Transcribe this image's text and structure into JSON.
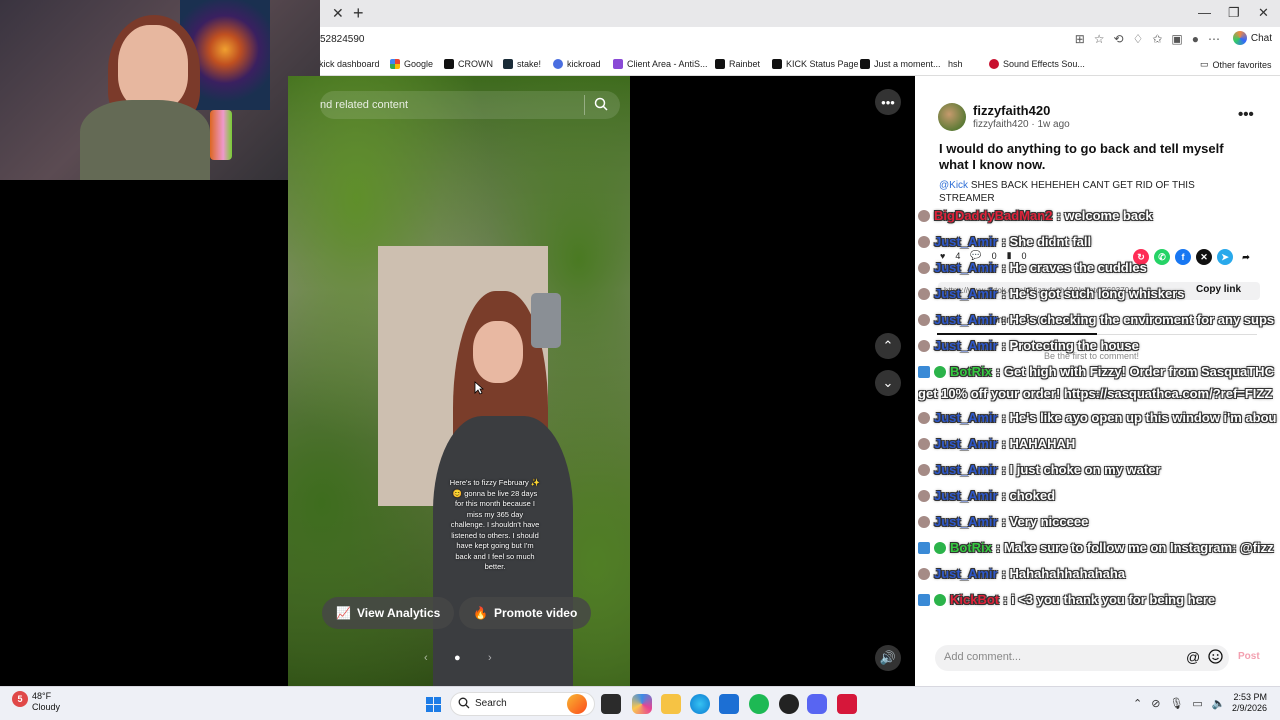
{
  "browser": {
    "url": "52824590",
    "chat_label": "Chat",
    "other_favorites": "Other favorites",
    "favorites": [
      {
        "label": "kick dashboard",
        "icon": "kick-icon"
      },
      {
        "label": "Google",
        "icon": "google-icon"
      },
      {
        "label": "CROWN",
        "icon": "crown-icon"
      },
      {
        "label": "stake!",
        "icon": "stake-icon"
      },
      {
        "label": "kickroad",
        "icon": "kickroad-icon"
      },
      {
        "label": "Client Area - AntiS...",
        "icon": "client-area-icon"
      },
      {
        "label": "Rainbet",
        "icon": "rainbet-icon"
      },
      {
        "label": "KICK Status Page",
        "icon": "kick-icon"
      },
      {
        "label": "Just a moment...",
        "icon": "kick-icon"
      },
      {
        "label": "hsh",
        "icon": "link-icon"
      },
      {
        "label": "Sound Effects Sou...",
        "icon": "sound-icon"
      }
    ]
  },
  "video": {
    "search_placeholder": "nd related content",
    "caption": "Here's to fizzy February ✨\n😊 gonna be live 28 days\nfor this month because I\nmiss my 365 day\nchallenge. I shouldn't have\nlistened to others. I should\nhave kept going but I'm\nback and I feel so much\nbetter.",
    "analytics_label": "View Analytics",
    "promote_label": "Promote video"
  },
  "post": {
    "display_name": "fizzyfaith420",
    "username": "fizzyfaith420",
    "age": "1w ago",
    "title": "I would do anything to go back and tell myself what I know now.",
    "mention": "@Kick",
    "description": " SHES BACK HEHEHEH CANT GET RID OF THIS STREAMER",
    "likes": "4",
    "comments": "0",
    "saves": "0",
    "link": "https://www.tiktok.com/@fizzyfaith420/photo/7603704...",
    "copy_link": "Copy link",
    "comments_tab": "Comments (0)",
    "empty_comments": "Be the first to comment!",
    "comment_placeholder": "Add comment...",
    "post_label": "Post"
  },
  "chat": [
    {
      "name": "BigDaddyBadMan2",
      "color": "#e0223a",
      "msg": ": welcome back",
      "badge": "usr"
    },
    {
      "name": "Just_Amir",
      "color": "#2d57c9",
      "msg": ": She didnt fall",
      "badge": "usr"
    },
    {
      "name": "Just_Amir",
      "color": "#2d57c9",
      "msg": ": He craves the cuddles",
      "badge": "usr"
    },
    {
      "name": "Just_Amir",
      "color": "#2d57c9",
      "msg": ": He's got such long whiskers",
      "badge": "usr"
    },
    {
      "name": "Just_Amir",
      "color": "#2d57c9",
      "msg": ": He's checking the enviroment for any sups",
      "badge": "usr"
    },
    {
      "name": "Just_Amir",
      "color": "#2d57c9",
      "msg": ": Protecting the house",
      "badge": "usr"
    },
    {
      "name": "BotRix",
      "color": "#35c940",
      "msg": ": Get high with Fizzy! Order from SasquaTHC",
      "badge": "bot"
    },
    {
      "name": "",
      "color": "#35c940",
      "msg": "get 10% off your order! https://sasquathca.com/?ref=FIZZ",
      "badge": "none"
    },
    {
      "name": "Just_Amir",
      "color": "#2d57c9",
      "msg": ": He's like ayo open up this window i'm abou",
      "badge": "usr"
    },
    {
      "name": "Just_Amir",
      "color": "#2d57c9",
      "msg": ": HAHAHAH",
      "badge": "usr"
    },
    {
      "name": "Just_Amir",
      "color": "#2d57c9",
      "msg": ": I just choke on my water",
      "badge": "usr"
    },
    {
      "name": "Just_Amir",
      "color": "#2d57c9",
      "msg": ": choked",
      "badge": "usr"
    },
    {
      "name": "Just_Amir",
      "color": "#2d57c9",
      "msg": ": Very nicceee",
      "badge": "usr"
    },
    {
      "name": "BotRix",
      "color": "#35c940",
      "msg": ": Make sure to follow me on Instagram: @fizz",
      "badge": "bot"
    },
    {
      "name": "Just_Amir",
      "color": "#2d57c9",
      "msg": ": Hahahahhahahaha",
      "badge": "usr"
    },
    {
      "name": "KickBot",
      "color": "#e0223a",
      "msg": ": i <3 you thank you for being here",
      "badge": "bot"
    }
  ],
  "taskbar": {
    "temp": "48°F",
    "weather": "Cloudy",
    "alert_count": "5",
    "search_label": "Search",
    "time": "2:53 PM",
    "date": "2/9/2026"
  }
}
